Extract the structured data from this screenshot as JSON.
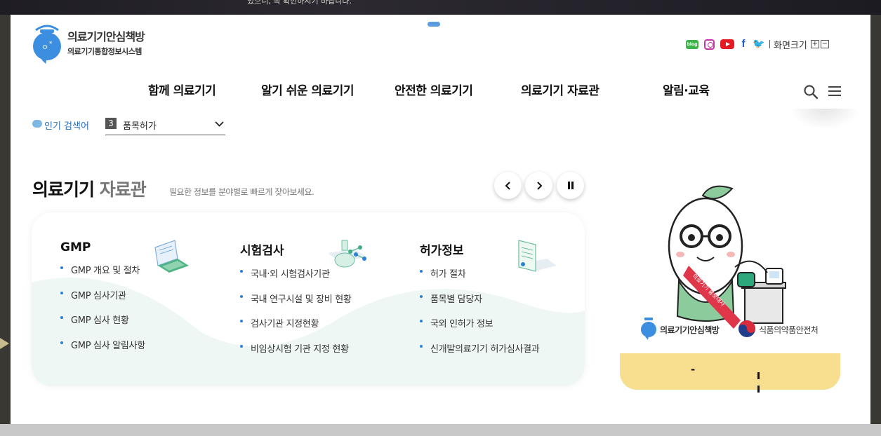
{
  "topbar": {
    "text": "있으니, 꼭 확인하시기 바랍니다."
  },
  "logo": {
    "title": "의료기기안심책방",
    "subtitle": "의료기기통합정보시스템"
  },
  "sns": {
    "blog_label": "blog",
    "facebook_glyph": "f",
    "twitter_glyph": "🐦"
  },
  "zoom": {
    "label": "화면크기",
    "plus": "+",
    "minus": "−"
  },
  "nav": {
    "items": [
      "함께 의료기기",
      "알기 쉬운 의료기기",
      "안전한 의료기기",
      "의료기기 자료관",
      "알림·교육"
    ]
  },
  "popular": {
    "label": "인기 검색어",
    "rank": "3",
    "keyword": "품목허가"
  },
  "section": {
    "title_main": "의료기기",
    "title_accent": "자료관",
    "subtitle": "필요한 정보를 분야별로 빠르게 찾아보세요."
  },
  "columns": [
    {
      "title": "GMP",
      "items": [
        "GMP 개요 및 절차",
        "GMP 심사기관",
        "GMP 심사 현황",
        "GMP 심사 알림사항"
      ]
    },
    {
      "title": "시험검사",
      "items": [
        "국내·외 시험검사기관",
        "국내 연구시설 및 장비 현황",
        "검사기관 지정현황",
        "비임상시험 기관 지정 현황"
      ]
    },
    {
      "title": "허가정보",
      "items": [
        "허가 절차",
        "품목별 담당자",
        "국외 인허가 정보",
        "신개발의료기기 허가심사결과"
      ]
    }
  ],
  "banner": {
    "sash_text": "의료기기 홍보대사",
    "logo1": "의료기기안심책방",
    "logo2": "식품의약품안전처",
    "counter": "-"
  },
  "colors": {
    "accent": "#2d7fd6",
    "banner_bottom": "#f7df8f",
    "mint": "#eef7f4"
  }
}
